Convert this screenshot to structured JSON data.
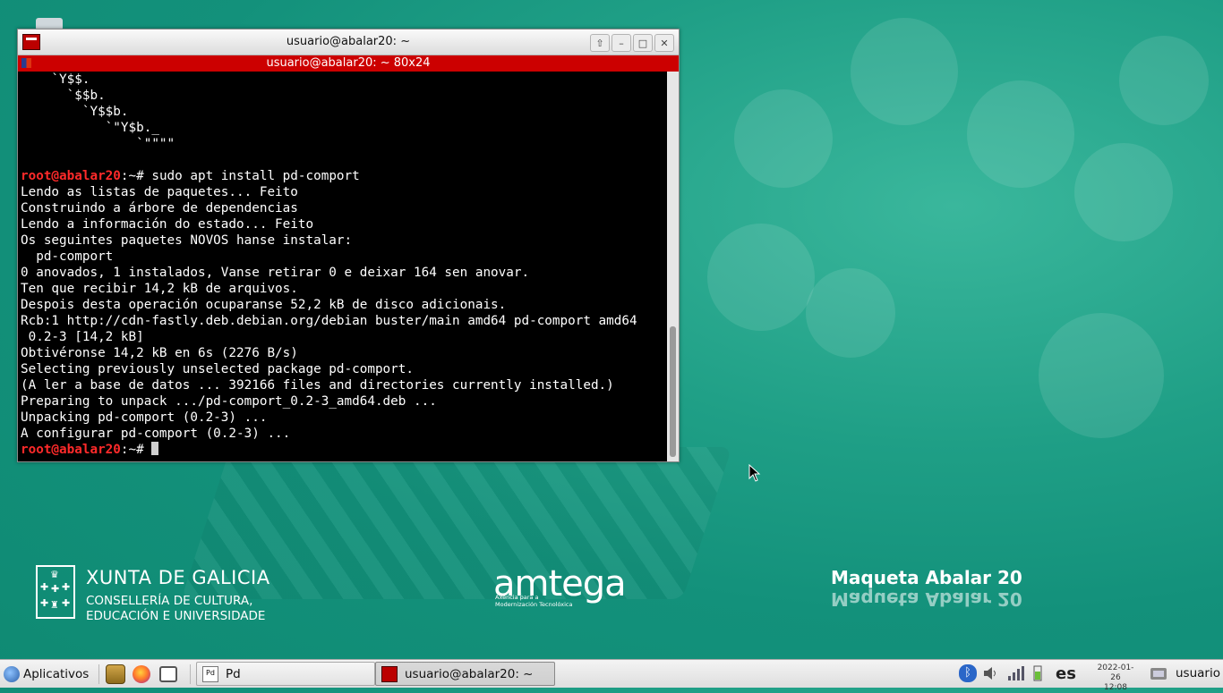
{
  "window": {
    "title": "usuario@abalar20: ~",
    "tab_title": "usuario@abalar20: ~ 80x24",
    "buttons": [
      "shade-up",
      "minimize",
      "maximize",
      "close"
    ]
  },
  "terminal": {
    "lines": [
      {
        "text": "    `Y$$."
      },
      {
        "text": "      `$$b."
      },
      {
        "text": "        `Y$$b."
      },
      {
        "text": "           `\"Y$b._"
      },
      {
        "text": "               `\"\"\"\""
      },
      {
        "text": ""
      },
      {
        "prompt": "root@abalar20",
        "suffix": ":~# ",
        "text": "sudo apt install pd-comport"
      },
      {
        "text": "Lendo as listas de paquetes... Feito"
      },
      {
        "text": "Construindo a árbore de dependencias"
      },
      {
        "text": "Lendo a información do estado... Feito"
      },
      {
        "text": "Os seguintes paquetes NOVOS hanse instalar:"
      },
      {
        "text": "  pd-comport"
      },
      {
        "text": "0 anovados, 1 instalados, Vanse retirar 0 e deixar 164 sen anovar."
      },
      {
        "text": "Ten que recibir 14,2 kB de arquivos."
      },
      {
        "text": "Despois desta operación ocuparanse 52,2 kB de disco adicionais."
      },
      {
        "text": "Rcb:1 http://cdn-fastly.deb.debian.org/debian buster/main amd64 pd-comport amd64"
      },
      {
        "text": " 0.2-3 [14,2 kB]"
      },
      {
        "text": "Obtivéronse 14,2 kB en 6s (2276 B/s)"
      },
      {
        "text": "Selecting previously unselected package pd-comport."
      },
      {
        "text": "(A ler a base de datos ... 392166 files and directories currently installed.)"
      },
      {
        "text": "Preparing to unpack .../pd-comport_0.2-3_amd64.deb ..."
      },
      {
        "text": "Unpacking pd-comport (0.2-3) ..."
      },
      {
        "text": "A configurar pd-comport (0.2-3) ..."
      },
      {
        "prompt": "root@abalar20",
        "suffix": ":~# ",
        "text": "",
        "cursor": true
      }
    ]
  },
  "desktop": {
    "xunta_title": "XUNTA DE GALICIA",
    "xunta_line1": "CONSELLERÍA DE CULTURA,",
    "xunta_line2": "EDUCACIÓN E UNIVERSIDADE",
    "amtega_name": "amtega",
    "amtega_sub1": "Axencia para a",
    "amtega_sub2": "Modernización Tecnolóxica",
    "maqueta": "Maqueta Abalar 20"
  },
  "taskbar": {
    "apps_label": "Aplicativos",
    "tasks": [
      {
        "label": "Pd",
        "active": false
      },
      {
        "label": "usuario@abalar20: ~",
        "active": true
      }
    ],
    "lang": "es",
    "date": "2022-01-26",
    "time": "12:08",
    "user": "usuario"
  },
  "colors": {
    "desktop_bg": "#13917b",
    "tab_red": "#cc0000",
    "prompt_red": "#ff2a2a"
  }
}
